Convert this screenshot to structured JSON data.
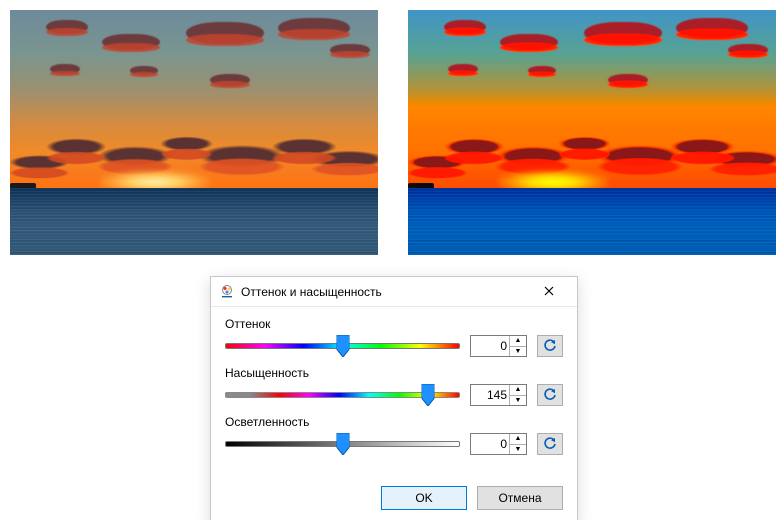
{
  "dialog": {
    "title": "Оттенок и насыщенность",
    "sliders": {
      "hue": {
        "label": "Оттенок",
        "value": 0,
        "min": -180,
        "max": 180
      },
      "saturation": {
        "label": "Насыщенность",
        "value": 145,
        "min": -200,
        "max": 200
      },
      "lightness": {
        "label": "Осветленность",
        "value": 0,
        "min": -100,
        "max": 100
      }
    },
    "buttons": {
      "ok": "OK",
      "cancel": "Отмена"
    }
  },
  "icons": {
    "close": "close-icon",
    "reset": "undo-arrow-icon"
  },
  "images": {
    "left": {
      "desc": "original sunset over sea"
    },
    "right": {
      "desc": "saturated sunset over sea (saturation +145)"
    }
  }
}
